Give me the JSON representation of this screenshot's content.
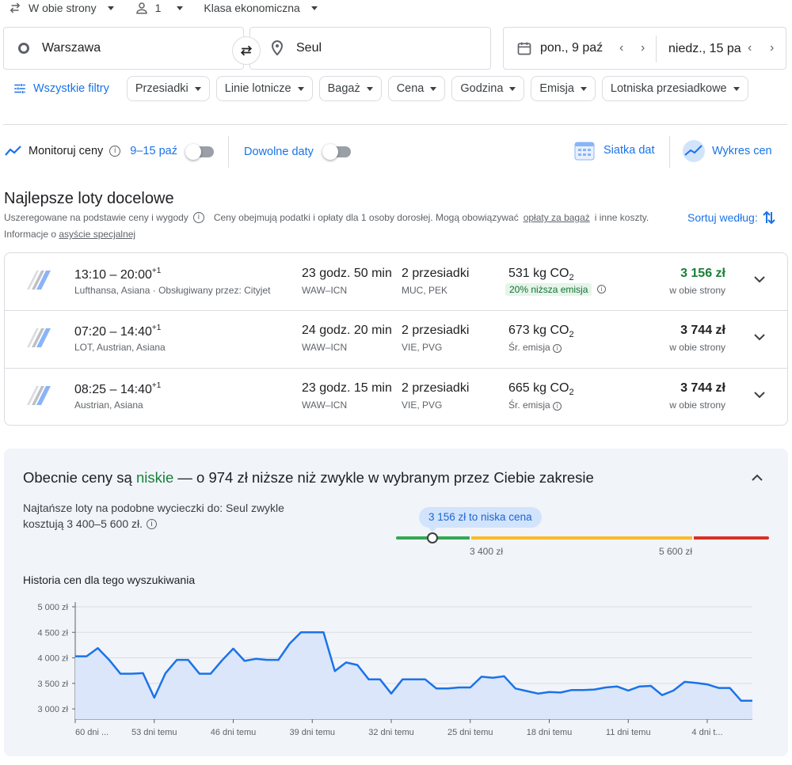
{
  "top": {
    "trip_type": "W obie strony",
    "passengers": "1",
    "cabin": "Klasa ekonomiczna"
  },
  "search": {
    "origin": "Warszawa",
    "destination": "Seul",
    "depart_date": "pon., 9 paź",
    "return_date": "niedz., 15 pa"
  },
  "filters": {
    "all_filters": "Wszystkie filtry",
    "chips": [
      "Przesiadki",
      "Linie lotnicze",
      "Bagaż",
      "Cena",
      "Godzina",
      "Emisja",
      "Lotniska przesiadkowe"
    ]
  },
  "tracking": {
    "label": "Monitoruj ceny",
    "dates": "9–15 paź",
    "any_dates": "Dowolne daty",
    "grid": "Siatka dat",
    "graph": "Wykres cen"
  },
  "results": {
    "heading": "Najlepsze loty docelowe",
    "ranked": "Uszeregowane na podstawie ceny i wygody",
    "note_a": "Ceny obejmują podatki i opłaty dla 1 osoby dorosłej. Mogą obowiązywać",
    "note_link": "opłaty za bagaż",
    "note_b": "i inne koszty.",
    "info_prefix": "Informacje o",
    "info_link": "asyście specjalnej",
    "sort": "Sortuj według:",
    "flights": [
      {
        "dep": "13:10",
        "arr": "20:00",
        "plus": "+1",
        "airlines": "Lufthansa, Asiana · Obsługiwany przez: Cityjet",
        "duration": "23 godz. 50 min",
        "route": "WAW–ICN",
        "stops": "2 przesiadki",
        "stop_codes": "MUC, PEK",
        "co2": "531 kg CO",
        "co2_note": "20% niższa emisja",
        "price": "3 156 zł",
        "price_note": "w obie strony"
      },
      {
        "dep": "07:20",
        "arr": "14:40",
        "plus": "+1",
        "airlines": "LOT, Austrian, Asiana",
        "duration": "24 godz. 20 min",
        "route": "WAW–ICN",
        "stops": "2 przesiadki",
        "stop_codes": "VIE, PVG",
        "co2": "673 kg CO",
        "co2_note": "Śr. emisja",
        "price": "3 744 zł",
        "price_note": "w obie strony"
      },
      {
        "dep": "08:25",
        "arr": "14:40",
        "plus": "+1",
        "airlines": "Austrian, Asiana",
        "duration": "23 godz. 15 min",
        "route": "WAW–ICN",
        "stops": "2 przesiadki",
        "stop_codes": "VIE, PVG",
        "co2": "665 kg CO",
        "co2_note": "Śr. emisja",
        "price": "3 744 zł",
        "price_note": "w obie strony"
      }
    ]
  },
  "insights": {
    "headline_a": "Obecnie ceny są",
    "headline_level": "niskie",
    "headline_b": "— o 974 zł niższe niż zwykle w wybranym przez Ciebie zakresie",
    "typical_line1": "Najtańsze loty na podobne wycieczki do: Seul zwykle",
    "typical_line2": "kosztują 3 400–5 600 zł.",
    "current_tooltip": "3 156 zł to niska cena",
    "range_low": "3 400 zł",
    "range_high": "5 600 zł",
    "current_price": 3156,
    "low_threshold": 3400,
    "high_threshold": 5600,
    "history_title": "Historia cen dla tego wyszukiwania"
  },
  "colors": {
    "accent": "#1a73e8",
    "green": "#188038",
    "yellow": "#f9bb2d",
    "red": "#d93025",
    "line": "#1a73e8"
  },
  "chart_data": {
    "type": "area",
    "title": "Historia cen dla tego wyszukiwania",
    "ylim": [
      2800,
      5000
    ],
    "yticks": [
      5000,
      4500,
      4000,
      3500,
      3000
    ],
    "ytick_labels": [
      "5 000 zł",
      "4 500 zł",
      "4 000 zł",
      "3 500 zł",
      "3 000 zł"
    ],
    "xtick_labels": [
      "60 dni ...",
      "53 dni temu",
      "46 dni temu",
      "39 dni temu",
      "32 dni temu",
      "25 dni temu",
      "18 dni temu",
      "11 dni temu",
      "4 dni t..."
    ],
    "xtick_days": [
      60,
      53,
      46,
      39,
      32,
      25,
      18,
      11,
      4
    ],
    "x_days_ago": [
      60,
      59,
      58,
      57,
      56,
      55,
      54,
      53,
      52,
      51,
      50,
      49,
      48,
      47,
      46,
      45,
      44,
      43,
      42,
      41,
      40,
      39,
      38,
      37,
      36,
      35,
      34,
      33,
      32,
      31,
      30,
      29,
      28,
      27,
      26,
      25,
      24,
      23,
      22,
      21,
      20,
      19,
      18,
      17,
      16,
      15,
      14,
      13,
      12,
      11,
      10,
      9,
      8,
      7,
      6,
      5,
      4,
      3,
      2,
      1,
      0
    ],
    "values": [
      4030,
      4030,
      4190,
      3960,
      3690,
      3690,
      3700,
      3220,
      3700,
      3960,
      3960,
      3690,
      3690,
      3950,
      4180,
      3940,
      3980,
      3960,
      3960,
      4280,
      4500,
      4500,
      4500,
      3740,
      3910,
      3860,
      3580,
      3580,
      3300,
      3580,
      3580,
      3580,
      3400,
      3400,
      3420,
      3420,
      3630,
      3610,
      3640,
      3400,
      3350,
      3300,
      3330,
      3320,
      3370,
      3370,
      3380,
      3420,
      3440,
      3360,
      3440,
      3450,
      3270,
      3360,
      3530,
      3510,
      3480,
      3410,
      3410,
      3160,
      3160
    ]
  }
}
